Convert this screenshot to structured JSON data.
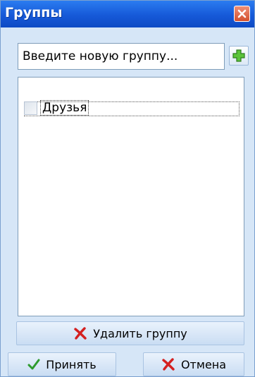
{
  "window": {
    "title": "Группы"
  },
  "new_group": {
    "placeholder": "Введите новую группу..."
  },
  "groups": [
    {
      "label": "Друзья",
      "checked": false
    }
  ],
  "buttons": {
    "delete_label": "Удалить группу",
    "accept_label": "Принять",
    "cancel_label": "Отмена"
  },
  "icons": {
    "close": "close-x-icon",
    "add": "plus-icon",
    "delete": "red-x-icon",
    "accept": "green-check-icon",
    "cancel": "red-x-icon"
  },
  "colors": {
    "titlebar": "#1659d8",
    "close_button": "#d3502d",
    "add_icon": "#4caf2f",
    "red_x": "#d42020",
    "green_check": "#2e9a2e"
  }
}
